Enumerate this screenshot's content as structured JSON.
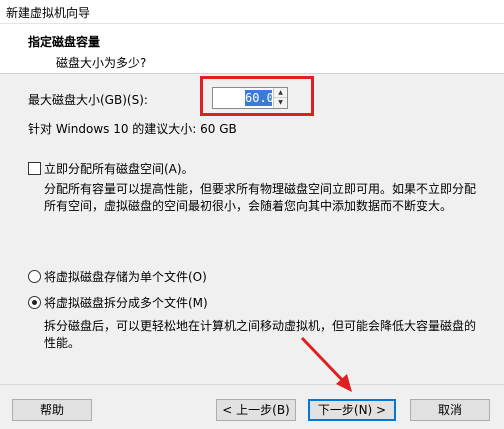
{
  "window": {
    "title": "新建虚拟机向导"
  },
  "header": {
    "title": "指定磁盘容量",
    "subtitle": "磁盘大小为多少?"
  },
  "disk": {
    "label": "最大磁盘大小(GB)(S):",
    "value": "60.0",
    "recommended": "针对 Windows 10 的建议大小: 60 GB"
  },
  "allocate": {
    "label": "立即分配所有磁盘空间(A)。",
    "checked": false,
    "description": "分配所有容量可以提高性能，但要求所有物理磁盘空间立即可用。如果不立即分配所有空间，虚拟磁盘的空间最初很小，会随着您向其中添加数据而不断变大。"
  },
  "storage": {
    "single_label": "将虚拟磁盘存储为单个文件(O)",
    "multi_label": "将虚拟磁盘拆分成多个文件(M)",
    "selected": "multi",
    "multi_description": "拆分磁盘后，可以更轻松地在计算机之间移动虚拟机，但可能会降低大容量磁盘的性能。"
  },
  "footer": {
    "help": "帮助",
    "back": "< 上一步(B)",
    "next": "下一步(N) >",
    "cancel": "取消"
  },
  "colors": {
    "highlight": "#e02020",
    "selection": "#3a7bd5",
    "default_button": "#0078d7"
  }
}
